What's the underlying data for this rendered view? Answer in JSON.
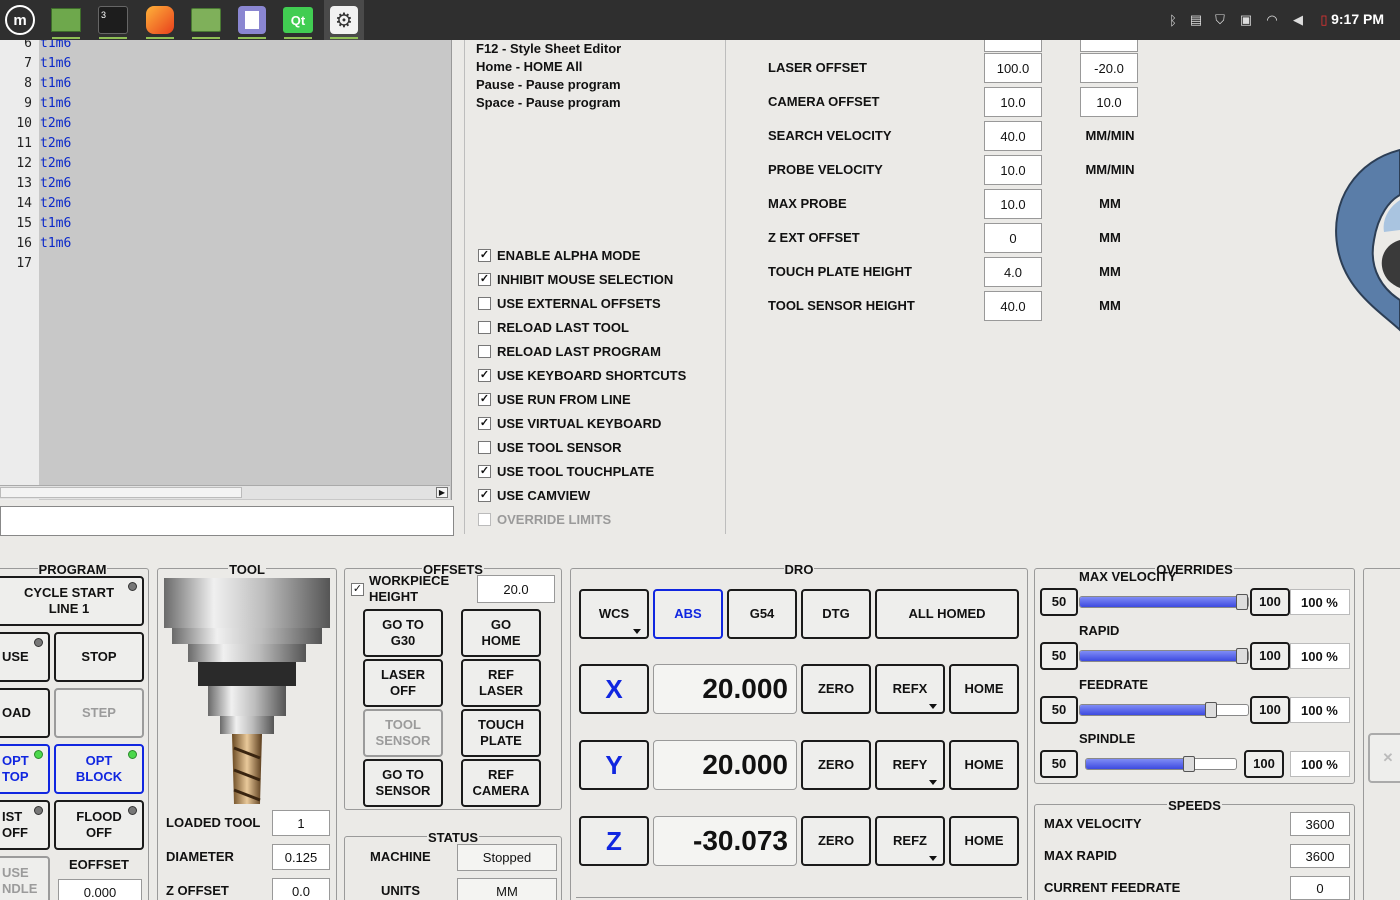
{
  "taskbar": {
    "apps": [
      {
        "name": "menu",
        "label": ""
      },
      {
        "name": "desktop",
        "label": ""
      },
      {
        "name": "terminal",
        "label": "3"
      },
      {
        "name": "firefox",
        "label": ""
      },
      {
        "name": "files",
        "label": ""
      },
      {
        "name": "text-editor",
        "label": ""
      },
      {
        "name": "qt",
        "label": "Qt"
      },
      {
        "name": "settings",
        "label": ""
      }
    ],
    "clock": "9:17 PM"
  },
  "editor": {
    "lines": [
      {
        "num": "6",
        "code": "t1m6"
      },
      {
        "num": "7",
        "code": "t1m6"
      },
      {
        "num": "8",
        "code": "t1m6"
      },
      {
        "num": "9",
        "code": "t1m6"
      },
      {
        "num": "10",
        "code": "t2m6"
      },
      {
        "num": "11",
        "code": "t2m6"
      },
      {
        "num": "12",
        "code": "t2m6"
      },
      {
        "num": "13",
        "code": "t2m6"
      },
      {
        "num": "14",
        "code": "t2m6"
      },
      {
        "num": "15",
        "code": "t1m6"
      },
      {
        "num": "16",
        "code": "t1m6"
      },
      {
        "num": "17",
        "code": ""
      }
    ]
  },
  "shortcuts": [
    "F12 - Style Sheet Editor",
    "Home - HOME All",
    "Pause - Pause program",
    "Space - Pause program"
  ],
  "options": [
    {
      "label": "ENABLE ALPHA MODE",
      "checked": "✓"
    },
    {
      "label": "INHIBIT MOUSE SELECTION",
      "checked": "✓"
    },
    {
      "label": "USE EXTERNAL OFFSETS",
      "checked": ""
    },
    {
      "label": "RELOAD LAST TOOL",
      "checked": ""
    },
    {
      "label": "RELOAD LAST PROGRAM",
      "checked": ""
    },
    {
      "label": "USE KEYBOARD SHORTCUTS",
      "checked": "✓"
    },
    {
      "label": "USE RUN FROM LINE",
      "checked": "✓"
    },
    {
      "label": "USE VIRTUAL KEYBOARD",
      "checked": "✓"
    },
    {
      "label": "USE TOOL SENSOR",
      "checked": ""
    },
    {
      "label": "USE TOOL TOUCHPLATE",
      "checked": "✓"
    },
    {
      "label": "USE CAMVIEW",
      "checked": "✓"
    },
    {
      "label": "OVERRIDE LIMITS",
      "checked": ""
    }
  ],
  "offset_settings": [
    {
      "label": "LASER OFFSET",
      "v1": "100.0",
      "v2": "-20.0",
      "unit": ""
    },
    {
      "label": "CAMERA OFFSET",
      "v1": "10.0",
      "v2": "10.0",
      "unit": ""
    },
    {
      "label": "SEARCH VELOCITY",
      "v1": "40.0",
      "v2": "",
      "unit": "MM/MIN"
    },
    {
      "label": "PROBE VELOCITY",
      "v1": "10.0",
      "v2": "",
      "unit": "MM/MIN"
    },
    {
      "label": "MAX PROBE",
      "v1": "10.0",
      "v2": "",
      "unit": "MM"
    },
    {
      "label": "Z EXT OFFSET",
      "v1": "0",
      "v2": "",
      "unit": "MM"
    },
    {
      "label": "TOUCH PLATE HEIGHT",
      "v1": "4.0",
      "v2": "",
      "unit": "MM"
    },
    {
      "label": "TOOL SENSOR HEIGHT",
      "v1": "40.0",
      "v2": "",
      "unit": "MM"
    }
  ],
  "program": {
    "title": "PROGRAM",
    "cycle_start": "CYCLE START\nLINE 1",
    "pause": "USE",
    "stop": "STOP",
    "load": "OAD",
    "step": "STEP",
    "opt_stop": "OPT\nTOP",
    "opt_block": "OPT\nBLOCK",
    "mist": "IST\nOFF",
    "flood": "FLOOD\nOFF",
    "pause_spindle": "USE\nNDLE",
    "eoffset_label": "EOFFSET",
    "eoffset_value": "0.000"
  },
  "tool": {
    "title": "TOOL",
    "loaded_tool_label": "LOADED TOOL",
    "loaded_tool": "1",
    "diameter_label": "DIAMETER",
    "diameter": "0.125",
    "zoffset_label": "Z OFFSET",
    "zoffset": "0.0"
  },
  "offsets": {
    "title": "OFFSETS",
    "workpiece_label": "WORKPIECE\nHEIGHT",
    "workpiece_checked": "✓",
    "workpiece_value": "20.0",
    "go_g30": "GO TO\nG30",
    "go_home": "GO\nHOME",
    "laser_off": "LASER\nOFF",
    "ref_laser": "REF\nLASER",
    "tool_sensor": "TOOL\nSENSOR",
    "touch_plate": "TOUCH\nPLATE",
    "go_sensor": "GO TO\nSENSOR",
    "ref_camera": "REF\nCAMERA"
  },
  "status": {
    "title": "STATUS",
    "machine_label": "MACHINE",
    "machine": "Stopped",
    "units_label": "UNITS",
    "units": "MM"
  },
  "dro": {
    "title": "DRO",
    "wcs": "WCS",
    "abs": "ABS",
    "g54": "G54",
    "dtg": "DTG",
    "homed": "ALL HOMED",
    "axes": [
      {
        "axis": "X",
        "value": "20.000",
        "zero": "ZERO",
        "ref": "REFX",
        "home": "HOME"
      },
      {
        "axis": "Y",
        "value": "20.000",
        "zero": "ZERO",
        "ref": "REFY",
        "home": "HOME"
      },
      {
        "axis": "Z",
        "value": "-30.073",
        "zero": "ZERO",
        "ref": "REFZ",
        "home": "HOME"
      }
    ]
  },
  "overrides": {
    "title": "OVERRIDES",
    "rows": [
      {
        "label": "MAX VELOCITY",
        "min": "50",
        "max": "100",
        "pct": "100 %",
        "level": 1.0
      },
      {
        "label": "RAPID",
        "min": "50",
        "max": "100",
        "pct": "100 %",
        "level": 1.0
      },
      {
        "label": "FEEDRATE",
        "min": "50",
        "max": "100",
        "pct": "100 %",
        "level": 0.8
      },
      {
        "label": "SPINDLE",
        "min": "50",
        "max": "100",
        "pct": "100 %",
        "level": 0.7
      }
    ]
  },
  "speeds": {
    "title": "SPEEDS",
    "rows": [
      {
        "label": "MAX VELOCITY",
        "value": "3600"
      },
      {
        "label": "MAX RAPID",
        "value": "3600"
      },
      {
        "label": "CURRENT FEEDRATE",
        "value": "0"
      }
    ]
  },
  "colors": {
    "accent_blue": "#1026e0",
    "led_green": "#4cd84c",
    "taskbar": "#2f2f2f"
  }
}
